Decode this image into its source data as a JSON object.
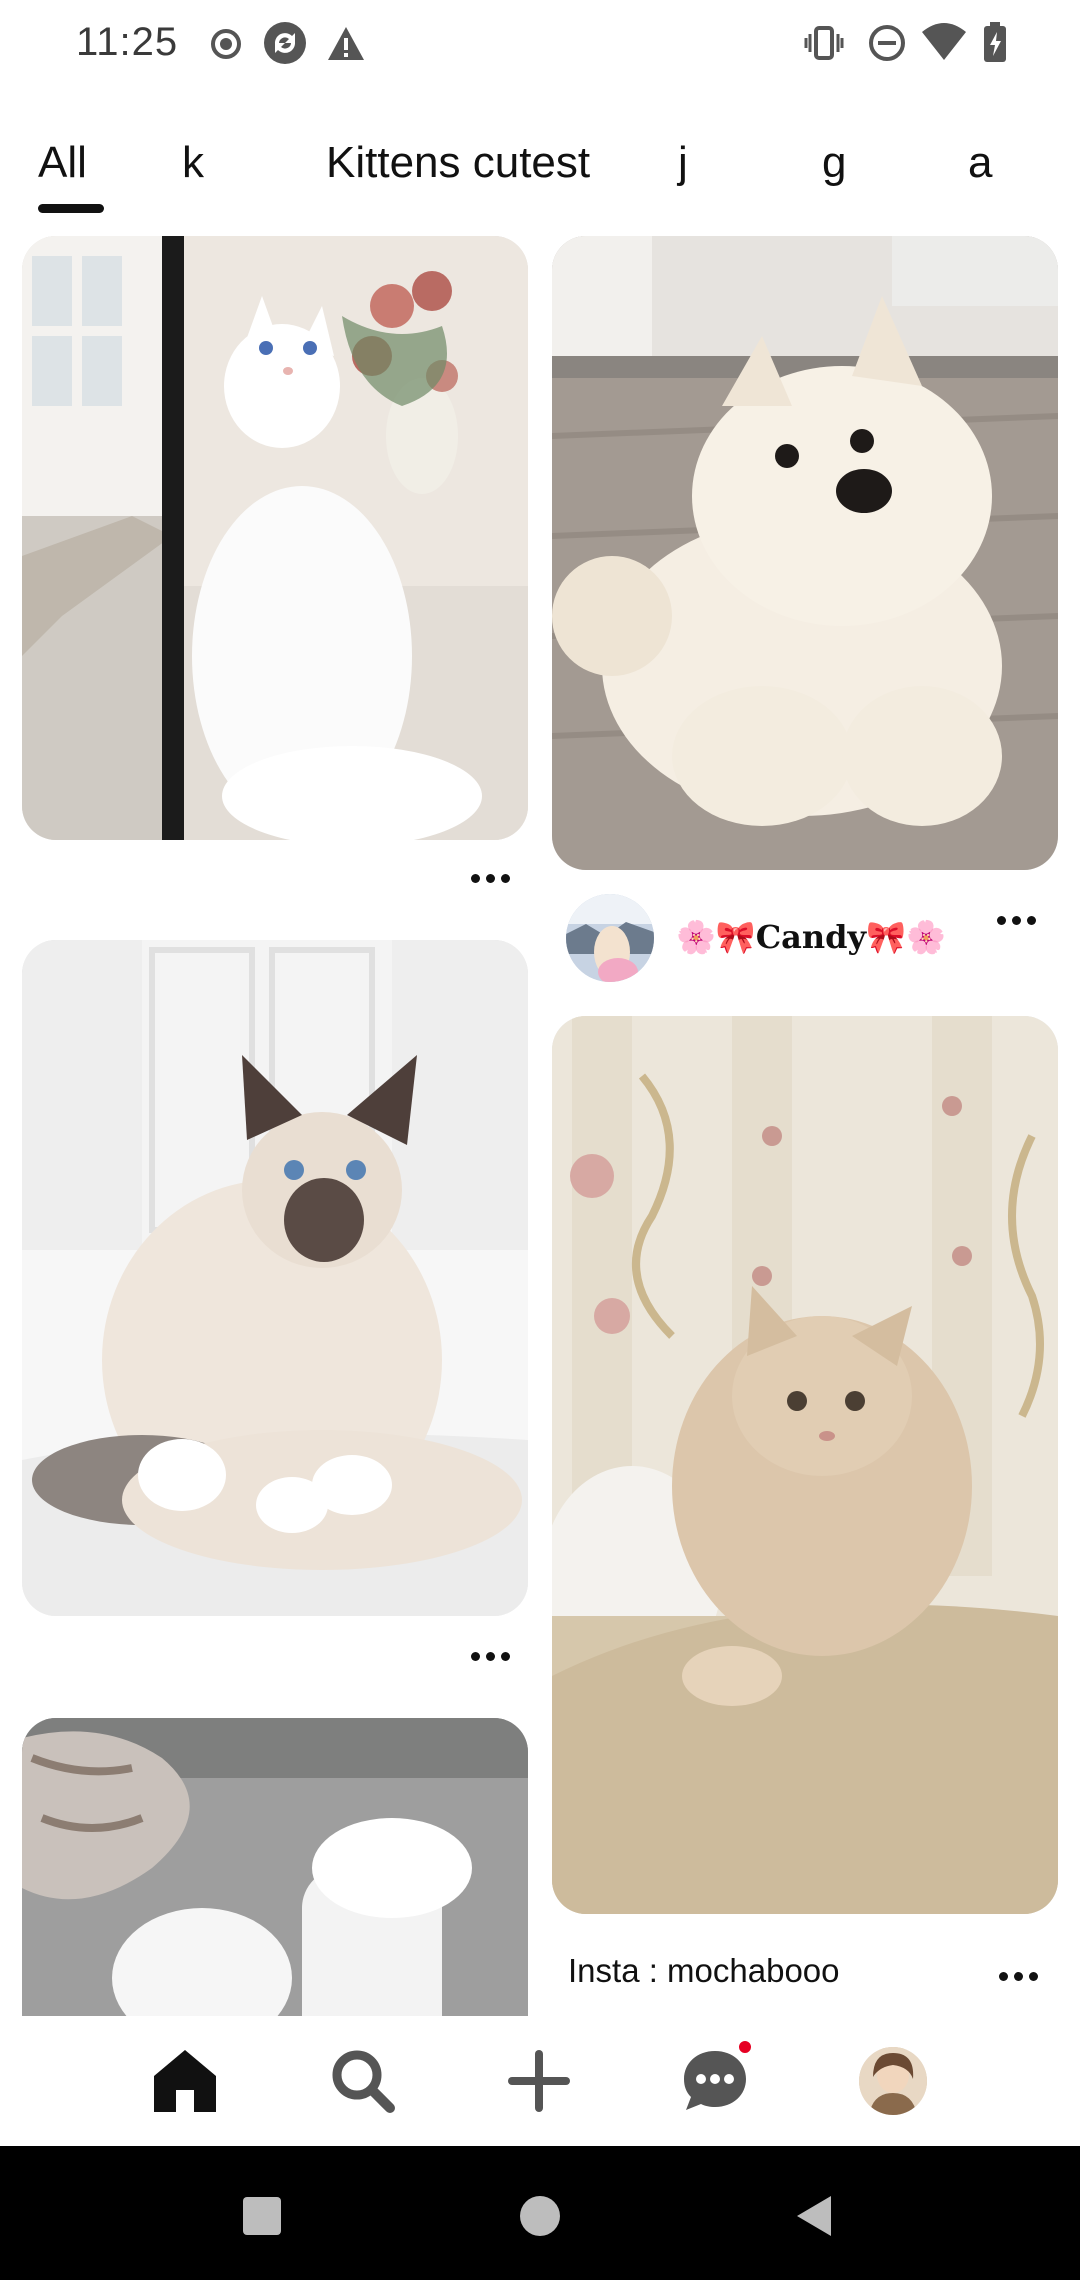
{
  "status_bar": {
    "time": "11:25",
    "left_icons": [
      "record-icon",
      "sync-app-icon",
      "warning-icon"
    ],
    "right_icons": [
      "vibrate-icon",
      "do-not-disturb-icon",
      "wifi-icon",
      "battery-charging-icon"
    ]
  },
  "tabs": [
    {
      "label": "All",
      "selected": true
    },
    {
      "label": "k",
      "selected": false
    },
    {
      "label": "Kittens cutest",
      "selected": false
    },
    {
      "label": "j",
      "selected": false
    },
    {
      "label": "g",
      "selected": false
    },
    {
      "label": "a",
      "selected": false
    }
  ],
  "feed": {
    "pins": [
      {
        "name": "pin-white-cat",
        "image": "white long-haired cat by window with roses"
      },
      {
        "name": "pin-white-puppy",
        "image": "fluffy white samoyed puppy"
      },
      {
        "name": "pin-birman-cat",
        "image": "birman cat on white bed"
      },
      {
        "name": "pin-ginger-kitten",
        "image": "fluffy cream kitten on cushion"
      },
      {
        "name": "pin-white-fur-slippers",
        "image": "white fur slippers"
      }
    ],
    "author": {
      "name": "🌸🎀Candy🎀🌸"
    },
    "caption": "Insta : mochabooo"
  },
  "bottom_nav": {
    "items": [
      "home-icon",
      "search-icon",
      "create-icon",
      "messages-icon",
      "profile-avatar"
    ],
    "messages_has_notification": true
  },
  "system_nav": [
    "recents-button",
    "home-button",
    "back-button"
  ],
  "colors": {
    "accent": "#e60023",
    "text": "#111111",
    "background": "#ffffff"
  }
}
